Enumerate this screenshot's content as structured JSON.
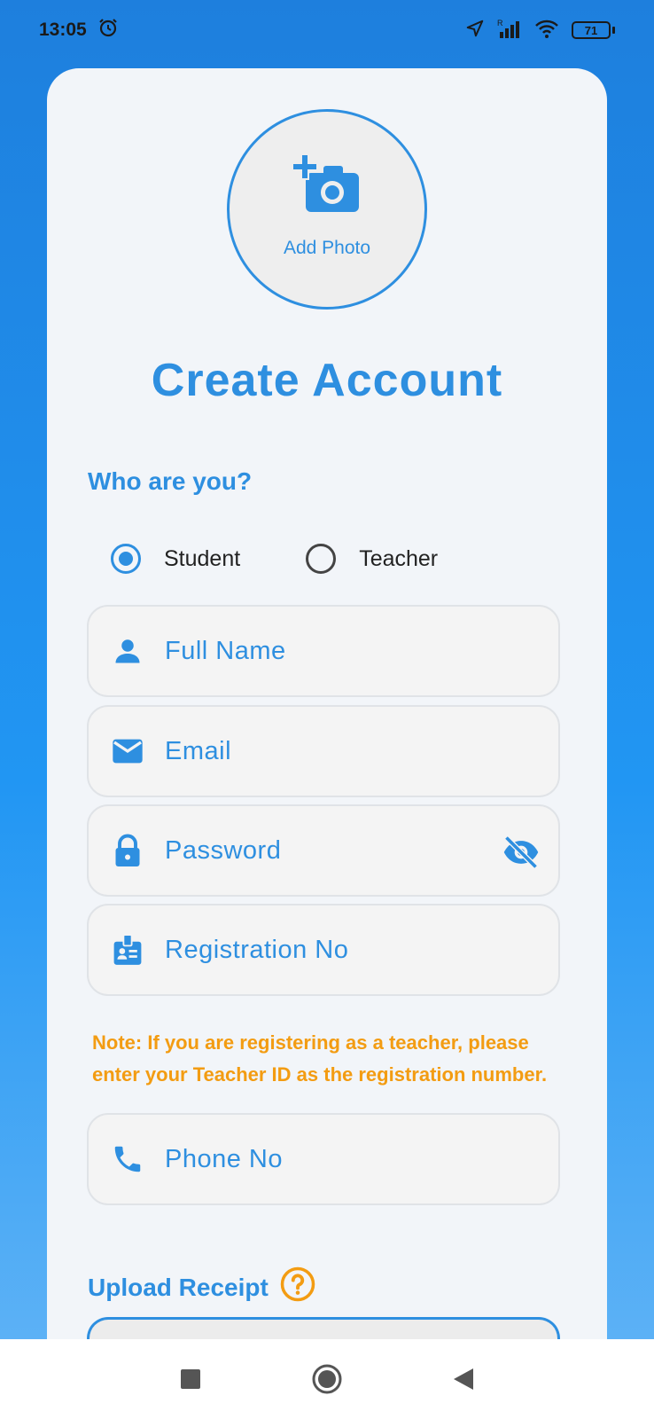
{
  "status_bar": {
    "time": "13:05",
    "battery": "71",
    "icons": [
      "alarm-icon",
      "location-arrow-icon",
      "signal-icon",
      "wifi-icon",
      "battery-icon"
    ]
  },
  "photo": {
    "label": "Add Photo",
    "icon": "add-a-photo-icon"
  },
  "title": "Create Account",
  "role": {
    "question": "Who are you?",
    "options": [
      {
        "label": "Student",
        "selected": true
      },
      {
        "label": "Teacher",
        "selected": false
      }
    ]
  },
  "fields": {
    "full_name": {
      "placeholder": "Full Name",
      "icon": "person-icon"
    },
    "email": {
      "placeholder": "Email",
      "icon": "email-icon"
    },
    "password": {
      "placeholder": "Password",
      "icon": "lock-icon",
      "trailing_icon": "visibility-off-icon"
    },
    "registration": {
      "placeholder": "Registration No",
      "icon": "badge-icon"
    },
    "phone": {
      "placeholder": "Phone No",
      "icon": "phone-icon"
    }
  },
  "note": "Note: If you are registering as a teacher, please enter your Teacher ID as the registration number.",
  "upload": {
    "label": "Upload Receipt",
    "help_icon": "help-icon"
  },
  "colors": {
    "accent": "#2e8fe0",
    "warning": "#f39c12",
    "card": "#f2f5f9"
  }
}
